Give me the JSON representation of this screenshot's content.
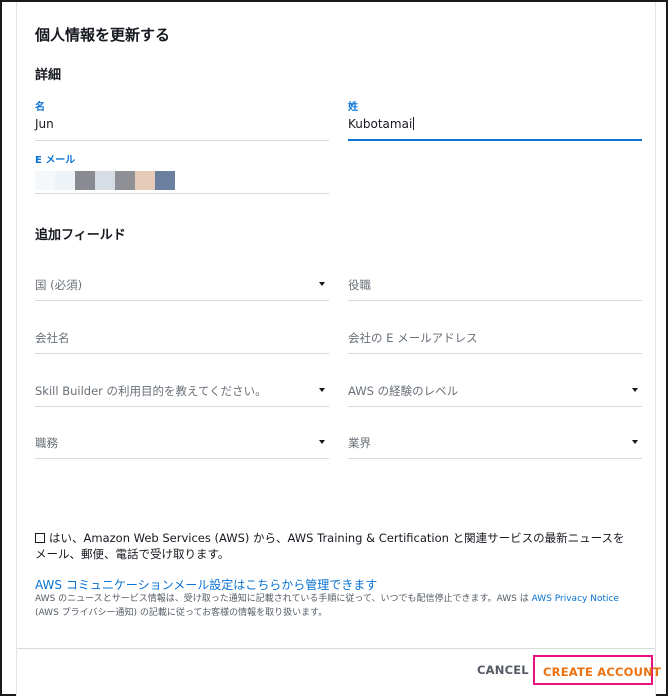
{
  "dialog": {
    "title": "個人情報を更新する",
    "details_heading": "詳細",
    "first_name": {
      "label": "名",
      "value": "Jun"
    },
    "last_name": {
      "label": "姓",
      "value": "Kubotamai"
    },
    "email": {
      "label": "E メール",
      "value_redacted_colors": [
        "#f4f8fb",
        "#eef3f7",
        "#8a8a93",
        "#d6dde4",
        "#8e9096",
        "#e6cbb8",
        "#6b7f9e"
      ]
    },
    "additional_heading": "追加フィールド",
    "fields": {
      "country": {
        "placeholder": "国 (必須)",
        "type": "dropdown"
      },
      "job_title": {
        "placeholder": "役職"
      },
      "company": {
        "placeholder": "会社名"
      },
      "company_email": {
        "placeholder": "会社の E メールアドレス"
      },
      "purpose": {
        "placeholder": "Skill Builder の利用目的を教えてください。",
        "type": "dropdown"
      },
      "aws_level": {
        "placeholder": "AWS の経験のレベル",
        "type": "dropdown"
      },
      "job_role": {
        "placeholder": "職務",
        "type": "dropdown"
      },
      "industry": {
        "placeholder": "業界",
        "type": "dropdown"
      }
    },
    "consent": {
      "checked": false,
      "text": "はい、Amazon Web Services (AWS) から、AWS Training & Certification と関連サービスの最新ニュースをメール、郵便、電話で受け取ります。"
    },
    "manage_link": "AWS コミュニケーションメール設定はこちらから管理できます",
    "notice": {
      "before": "AWS のニュースとサービス情報は、受け取った通知に記載されている手順に従って、いつでも配信停止できます。AWS は ",
      "link": "AWS Privacy Notice",
      "after": " (AWS プライバシー通知) の記載に従ってお客様の情報を取り扱います。"
    },
    "buttons": {
      "cancel": "CANCEL",
      "create": "CREATE ACCOUNT"
    }
  },
  "colors": {
    "accent": "#0972d3",
    "create_button_text": "#ec7211",
    "highlight_border": "#e8117f"
  }
}
